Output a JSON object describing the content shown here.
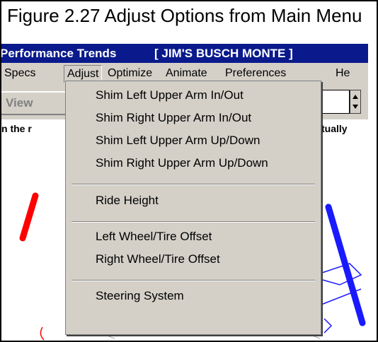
{
  "caption": "Figure 2.27  Adjust Options from Main Menu",
  "window": {
    "title_left": "Performance Trends",
    "title_right": "[ JIM'S BUSCH MONTE ]"
  },
  "menubar": {
    "items": [
      "Specs",
      "Adjust",
      "Optimize",
      "Animate",
      "Preferences",
      "He"
    ]
  },
  "toolbar": {
    "view_label": "View"
  },
  "instructions": {
    "left_fragment": "n the r",
    "right_fragment": "tually"
  },
  "adjust_menu": {
    "items": [
      "Shim Left Upper Arm In/Out",
      "Shim Right Upper Arm In/Out",
      "Shim Left Upper Arm Up/Down",
      "Shim Right Upper Arm Up/Down",
      "Ride Height",
      "Left Wheel/Tire Offset",
      "Right Wheel/Tire Offset",
      "Steering System"
    ]
  },
  "colors": {
    "titlebar": "#0a1a8c",
    "chrome": "#d4d0c8",
    "left_arm": "#ff0000",
    "right_arm": "#1a1aff"
  }
}
